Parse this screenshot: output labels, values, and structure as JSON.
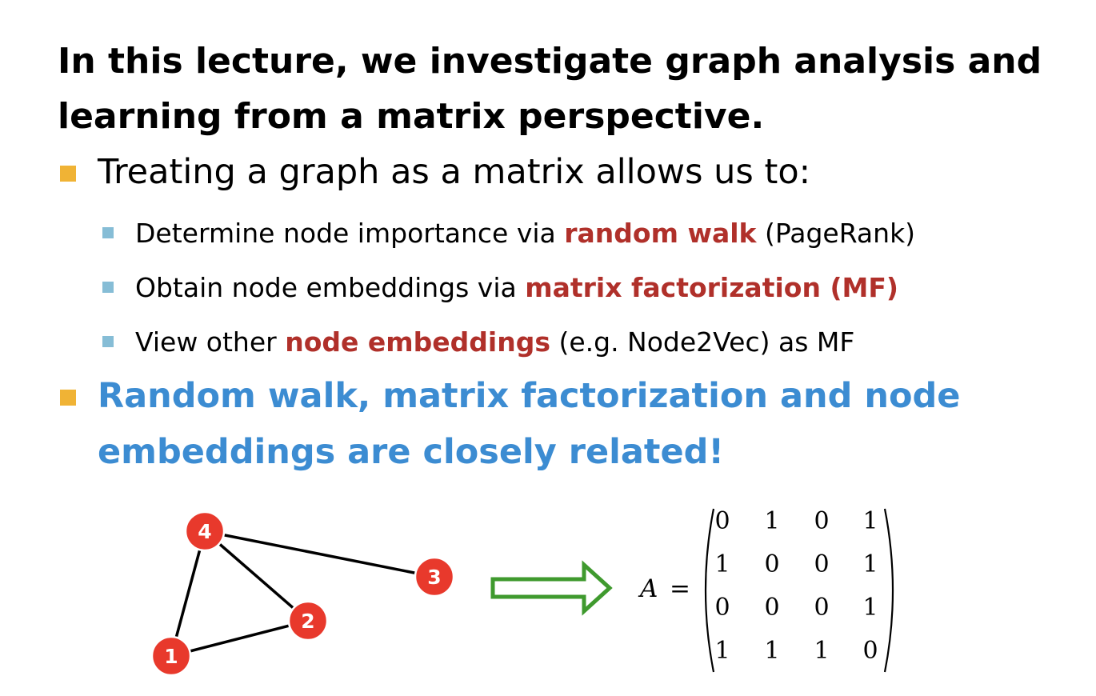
{
  "title": {
    "line1": "In this lecture, we investigate graph analysis and",
    "line2": "learning from a matrix perspective."
  },
  "bullet1": {
    "text": "Treating a graph as a matrix allows us to:"
  },
  "subbullets": [
    {
      "before": "Determine node importance via ",
      "highlight": "random walk",
      "after": " (PageRank)"
    },
    {
      "before": "Obtain node embeddings via ",
      "highlight": "matrix factorization (MF)",
      "after": ""
    },
    {
      "before": "View other ",
      "highlight": "node embeddings",
      "after": " (e.g. Node2Vec) as MF"
    }
  ],
  "bullet2": {
    "line1": "Random walk, matrix factorization and node",
    "line2": "embeddings are closely related!"
  },
  "graph": {
    "nodes": [
      "1",
      "2",
      "3",
      "4"
    ],
    "edges": [
      [
        "4",
        "1"
      ],
      [
        "4",
        "2"
      ],
      [
        "4",
        "3"
      ],
      [
        "1",
        "2"
      ]
    ],
    "node_color": "#e8392c"
  },
  "matrix": {
    "symbol": "A",
    "equals": "=",
    "rows": [
      [
        "0",
        "1",
        "0",
        "1"
      ],
      [
        "1",
        "0",
        "0",
        "1"
      ],
      [
        "0",
        "0",
        "0",
        "1"
      ],
      [
        "1",
        "1",
        "1",
        "0"
      ]
    ]
  },
  "colors": {
    "bullet_l1": "#f0b335",
    "bullet_l2": "#86bdd6",
    "highlight_red": "#b0302a",
    "emphasis_blue": "#3c8cd2",
    "arrow_green": "#3f9a2e"
  }
}
